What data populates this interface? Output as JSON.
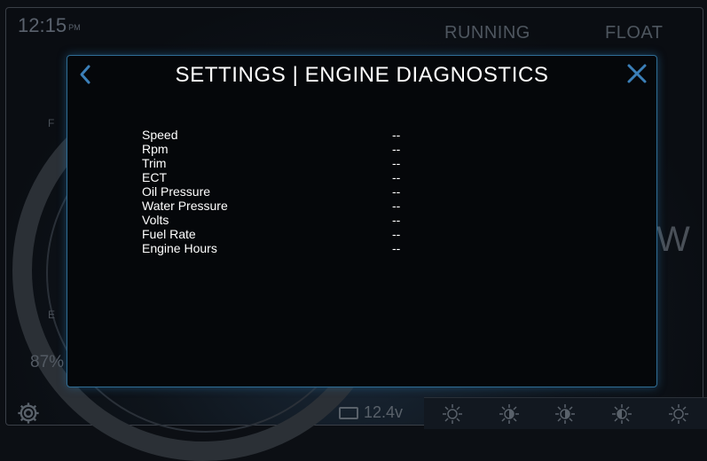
{
  "background": {
    "clock_time": "12:15",
    "clock_ampm": "PM",
    "status_left": "RUNNING",
    "status_right": "FLOAT",
    "gauge_full_label": "F",
    "gauge_empty_label": "E",
    "gauge_percent": "87%",
    "heading_letter": "W",
    "battery_voltage": "12.4v"
  },
  "modal": {
    "title": "SETTINGS | ENGINE DIAGNOSTICS",
    "rows": [
      {
        "label": "Speed",
        "value": "--"
      },
      {
        "label": "Rpm",
        "value": "--"
      },
      {
        "label": "Trim",
        "value": "--"
      },
      {
        "label": "ECT",
        "value": "--"
      },
      {
        "label": "Oil Pressure",
        "value": "--"
      },
      {
        "label": "Water Pressure",
        "value": "--"
      },
      {
        "label": "Volts",
        "value": "--"
      },
      {
        "label": "Fuel Rate",
        "value": "--"
      },
      {
        "label": "Engine Hours",
        "value": "--"
      }
    ]
  },
  "icons": {
    "back": "chevron-left-icon",
    "close": "close-icon",
    "settings": "gear-icon",
    "battery": "battery-icon",
    "brightness": [
      "sun-icon",
      "sun-half-icon",
      "sun-half-icon",
      "sun-half-icon",
      "sun-icon"
    ]
  },
  "colors": {
    "accent": "#2f6d95",
    "icon_blue": "#3b7fb8",
    "modal_bg": "#05070a"
  }
}
